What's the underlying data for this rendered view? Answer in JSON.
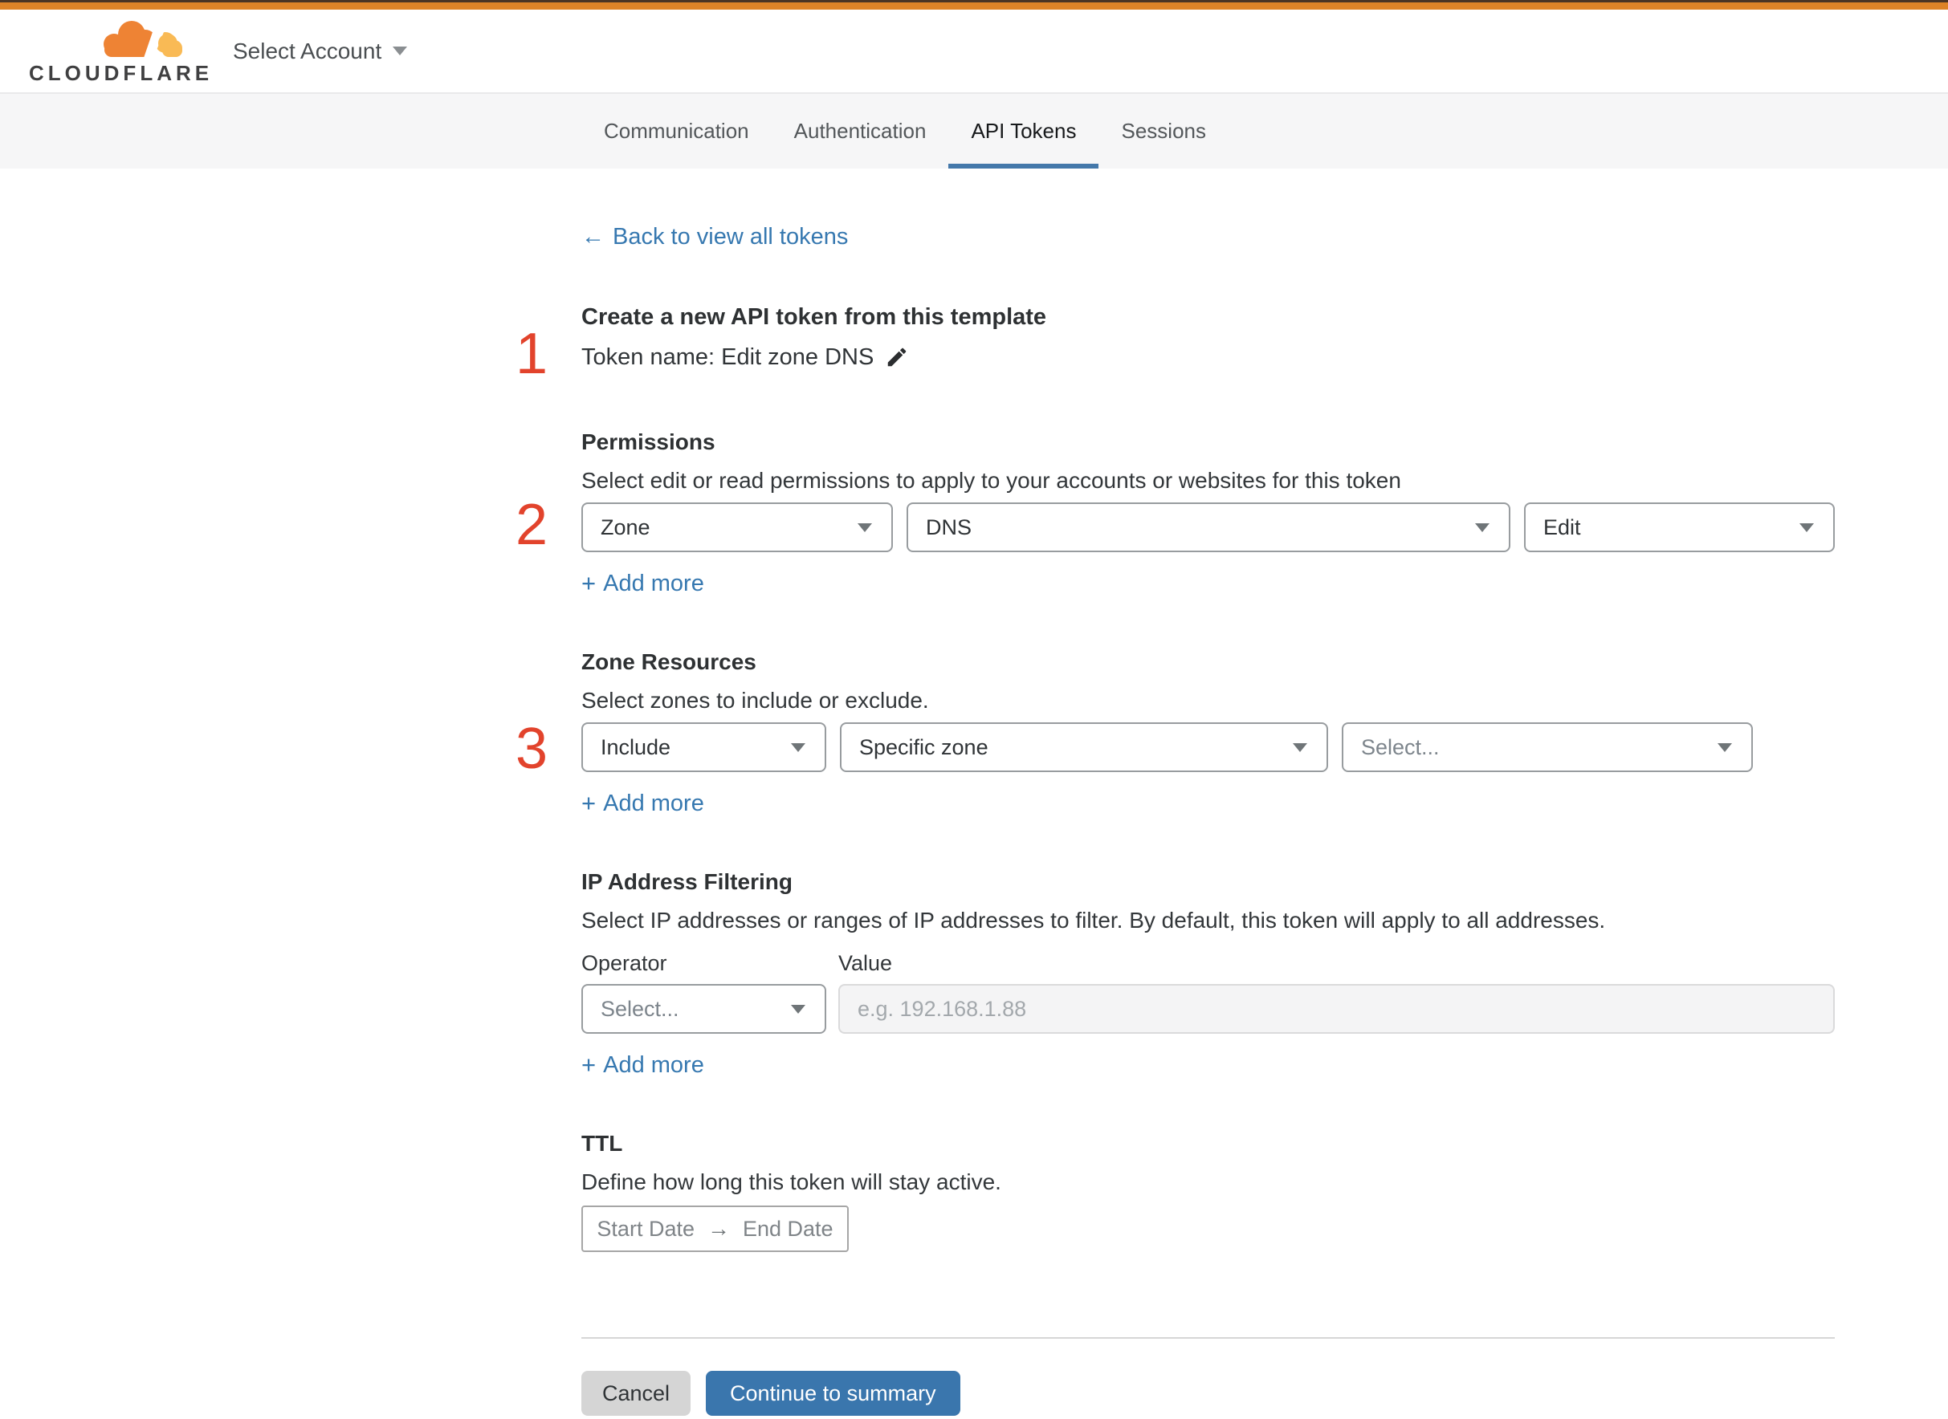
{
  "header": {
    "logo_text": "CLOUDFLARE",
    "account_selector": "Select Account"
  },
  "tabs": [
    {
      "label": "Communication",
      "active": false
    },
    {
      "label": "Authentication",
      "active": false
    },
    {
      "label": "API Tokens",
      "active": true
    },
    {
      "label": "Sessions",
      "active": false
    }
  ],
  "back_link": {
    "arrow": "←",
    "label": "Back to view all tokens"
  },
  "steps": {
    "one": "1",
    "two": "2",
    "three": "3"
  },
  "token": {
    "title": "Create a new API token from this template",
    "name_label": "Token name: Edit zone DNS"
  },
  "misc": {
    "plus": "+"
  },
  "permissions": {
    "heading": "Permissions",
    "description": "Select edit or read permissions to apply to your accounts or websites for this token",
    "selects": {
      "scope": "Zone",
      "resource": "DNS",
      "access": "Edit"
    },
    "add_more": "Add more"
  },
  "zone_resources": {
    "heading": "Zone Resources",
    "description": "Select zones to include or exclude.",
    "selects": {
      "mode": "Include",
      "type": "Specific zone",
      "zone_placeholder": "Select..."
    },
    "add_more": "Add more"
  },
  "ip_filtering": {
    "heading": "IP Address Filtering",
    "description": "Select IP addresses or ranges of IP addresses to filter. By default, this token will apply to all addresses.",
    "operator_label": "Operator",
    "value_label": "Value",
    "operator_placeholder": "Select...",
    "value_placeholder": "e.g. 192.168.1.88",
    "add_more": "Add more"
  },
  "ttl": {
    "heading": "TTL",
    "description": "Define how long this token will stay active.",
    "start": "Start Date",
    "arrow": "→",
    "end": "End Date"
  },
  "footer": {
    "cancel": "Cancel",
    "continue": "Continue to summary"
  },
  "colors": {
    "top_bar_orange": "#dd8327",
    "brand_orange": "#ee8334",
    "brand_orange_light": "#f9ba55",
    "link_blue": "#3678b0",
    "button_blue": "#3a76ad",
    "step_red": "#e2432c",
    "tab_underline": "#4478aa"
  }
}
